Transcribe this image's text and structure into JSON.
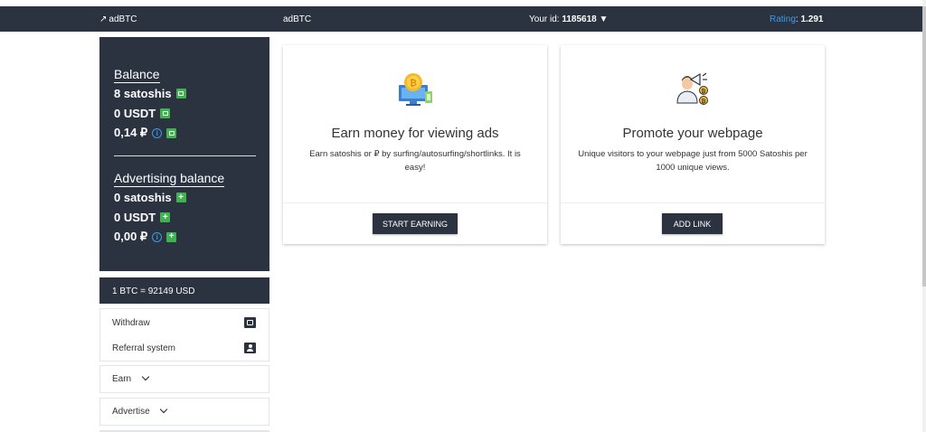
{
  "topbar": {
    "brand_link": "adBTC",
    "brand_center": "adBTC",
    "userid_label": "Your id: ",
    "userid_value": "1185618",
    "rating_label": "Rating",
    "rating_value": "1.291"
  },
  "balance": {
    "title": "Balance",
    "satoshis": "8 satoshis",
    "usdt": "0 USDT",
    "rub": "0,14 ₽"
  },
  "advertising": {
    "title": "Advertising balance",
    "satoshis": "0 satoshis",
    "usdt": "0 USDT",
    "rub": "0,00 ₽"
  },
  "rate": "1 BTC = 92149 USD",
  "menu": {
    "withdraw": "Withdraw",
    "referral": "Referral system",
    "earn": "Earn",
    "advertise": "Advertise"
  },
  "cards": {
    "earn": {
      "title": "Earn money for viewing ads",
      "desc": "Earn satoshis or ₽ by surfing/autosurfing/shortlinks. It is easy!",
      "button": "START EARNING"
    },
    "promote": {
      "title": "Promote your webpage",
      "desc": "Unique visitors to your webpage just from 5000 Satoshis per 1000 unique views.",
      "button": "ADD LINK"
    }
  },
  "colors": {
    "navy": "#2b3340",
    "green": "#3fb34f",
    "blue": "#3a9be8"
  },
  "icons": [
    "external-link-icon",
    "caret-down-icon",
    "wallet-icon",
    "info-icon",
    "plus-icon",
    "user-card-icon",
    "chevron-down-icon"
  ]
}
